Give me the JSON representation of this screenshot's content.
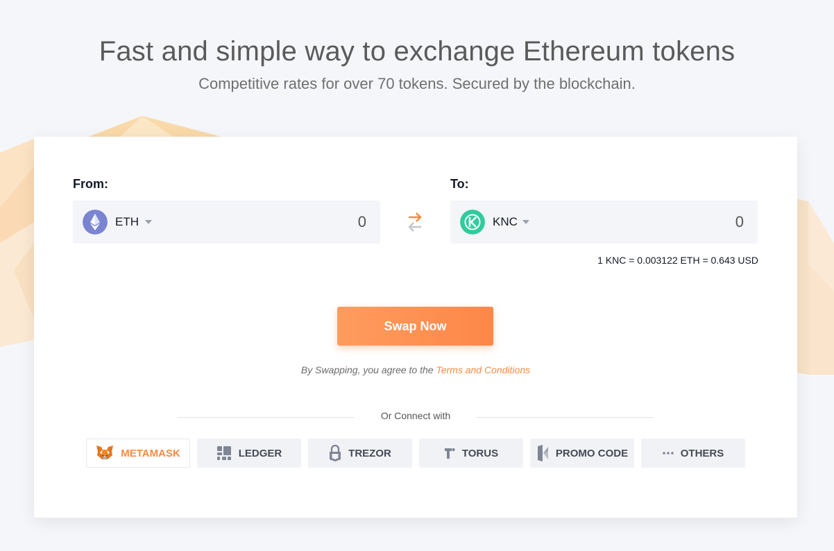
{
  "hero": {
    "title": "Fast and simple way to exchange Ethereum tokens",
    "subtitle": "Competitive rates for over 70 tokens. Secured by the blockchain."
  },
  "swap": {
    "from_label": "From:",
    "to_label": "To:",
    "from_token": {
      "symbol": "ETH",
      "amount": "0",
      "icon": "eth-icon",
      "color": "#7b84d1"
    },
    "to_token": {
      "symbol": "KNC",
      "amount": "0",
      "icon": "knc-icon",
      "color": "#31cb9e"
    },
    "rate": "1 KNC = 0.003122 ETH = 0.643 USD",
    "button_label": "Swap Now",
    "terms_prefix": "By Swapping, you agree to the ",
    "terms_link": "Terms and Conditions"
  },
  "connect": {
    "label": "Or Connect with",
    "wallets": [
      {
        "label": "METAMASK",
        "icon": "metamask-fox-icon",
        "active": true
      },
      {
        "label": "LEDGER",
        "icon": "ledger-icon",
        "active": false
      },
      {
        "label": "TREZOR",
        "icon": "trezor-lock-icon",
        "active": false
      },
      {
        "label": "TORUS",
        "icon": "torus-icon",
        "active": false
      },
      {
        "label": "PROMO CODE",
        "icon": "promo-code-icon",
        "active": false
      },
      {
        "label": "OTHERS",
        "icon": "more-dots-icon",
        "active": false
      }
    ]
  },
  "colors": {
    "accent": "#f88b43",
    "button_start": "#fe9c5e",
    "button_end": "#fd8748",
    "background": "#f5f6fa"
  }
}
